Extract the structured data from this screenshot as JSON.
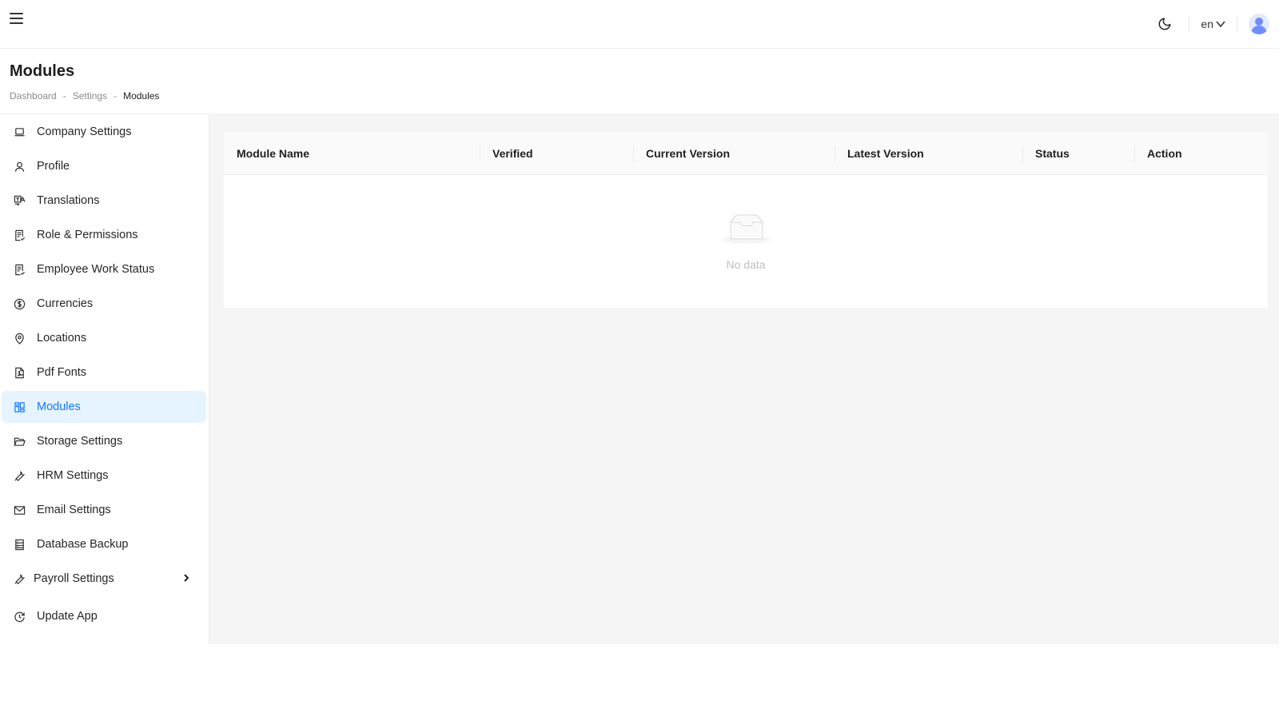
{
  "header": {
    "language": "en"
  },
  "page": {
    "title": "Modules",
    "breadcrumb": [
      "Dashboard",
      "Settings",
      "Modules"
    ]
  },
  "sidebar": {
    "items": [
      {
        "label": "Company Settings",
        "icon": "laptop-icon"
      },
      {
        "label": "Profile",
        "icon": "user-icon"
      },
      {
        "label": "Translations",
        "icon": "translation-icon"
      },
      {
        "label": "Role & Permissions",
        "icon": "checklist-icon"
      },
      {
        "label": "Employee Work Status",
        "icon": "checklist-icon"
      },
      {
        "label": "Currencies",
        "icon": "dollar-circle-icon"
      },
      {
        "label": "Locations",
        "icon": "location-pin-icon"
      },
      {
        "label": "Pdf Fonts",
        "icon": "pdf-file-icon"
      },
      {
        "label": "Modules",
        "icon": "grid-icon",
        "active": true
      },
      {
        "label": "Storage Settings",
        "icon": "folder-open-icon"
      },
      {
        "label": "HRM Settings",
        "icon": "tool-icon"
      },
      {
        "label": "Email Settings",
        "icon": "mail-icon"
      },
      {
        "label": "Database Backup",
        "icon": "database-icon"
      },
      {
        "label": "Payroll Settings",
        "icon": "tool-icon",
        "has_submenu": true
      },
      {
        "label": "Update App",
        "icon": "history-icon"
      }
    ]
  },
  "table": {
    "columns": [
      "Module Name",
      "Verified",
      "Current Version",
      "Latest Version",
      "Status",
      "Action"
    ],
    "rows": [],
    "empty_text": "No data"
  },
  "colors": {
    "accent": "#1677ff",
    "active_bg": "#e6f4ff",
    "content_bg": "#f5f5f5"
  }
}
